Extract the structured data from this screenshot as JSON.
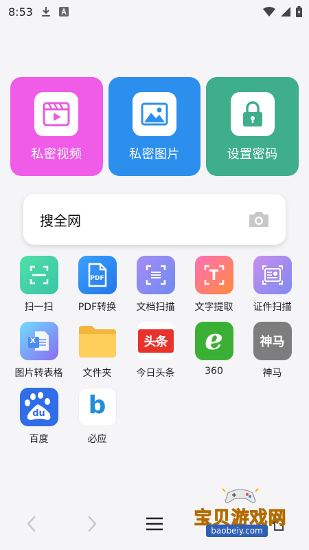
{
  "status_bar": {
    "time": "8:53"
  },
  "features": [
    {
      "label": "私密视频",
      "color": "#f05ce8",
      "icon": "video-icon"
    },
    {
      "label": "私密图片",
      "color": "#2c8fee",
      "icon": "image-icon"
    },
    {
      "label": "设置密码",
      "color": "#3fae8a",
      "icon": "lock-icon"
    }
  ],
  "search": {
    "label": "搜全网",
    "icon": "camera-icon"
  },
  "apps": [
    {
      "label": "扫一扫",
      "icon": "scan-icon"
    },
    {
      "label": "PDF转换",
      "icon": "pdf-icon",
      "icon_text": "PDF"
    },
    {
      "label": "文档扫描",
      "icon": "document-scan-icon"
    },
    {
      "label": "文字提取",
      "icon": "text-extract-icon",
      "icon_text": "T"
    },
    {
      "label": "证件扫描",
      "icon": "id-card-scan-icon"
    },
    {
      "label": "图片转表格",
      "icon": "image-to-table-icon",
      "icon_text": "X"
    },
    {
      "label": "文件夹",
      "icon": "folder-icon"
    },
    {
      "label": "今日头条",
      "icon": "toutiao-logo",
      "icon_text": "头条"
    },
    {
      "label": "360",
      "icon": "browser-360-logo",
      "icon_text": "e"
    },
    {
      "label": "神马",
      "icon": "shenma-logo",
      "icon_text": "神马"
    },
    {
      "label": "百度",
      "icon": "baidu-logo",
      "icon_text": "du"
    },
    {
      "label": "必应",
      "icon": "bing-logo",
      "icon_text": "b"
    }
  ],
  "watermark": {
    "text": "宝贝游戏网",
    "url": "baobeiy.com"
  }
}
